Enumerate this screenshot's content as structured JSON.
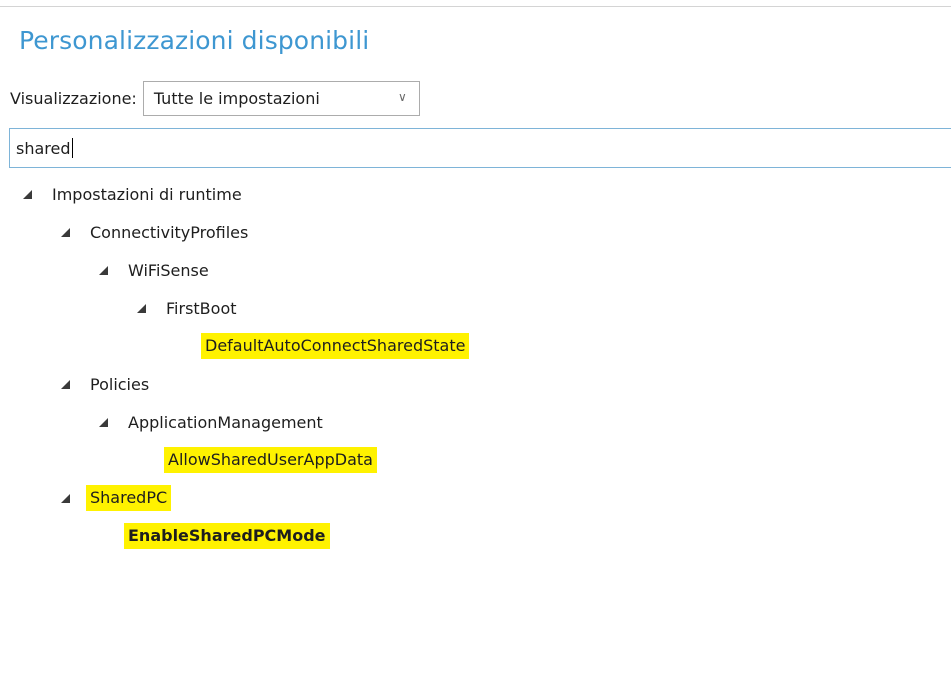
{
  "header": {
    "title": "Personalizzazioni disponibili"
  },
  "view": {
    "label": "Visualizzazione:",
    "selected": "Tutte le impostazioni"
  },
  "search": {
    "value": "shared"
  },
  "tree": {
    "runtime_settings": "Impostazioni di runtime",
    "connectivity_profiles": "ConnectivityProfiles",
    "wifisense": "WiFiSense",
    "firstboot": "FirstBoot",
    "default_auto_connect": "DefaultAutoConnectSharedState",
    "policies": "Policies",
    "application_management": "ApplicationManagement",
    "allow_shared_user_app_data": "AllowSharedUserAppData",
    "sharedpc": "SharedPC",
    "enable_sharedpc_mode": "EnableSharedPCMode"
  },
  "colors": {
    "title": "#3e97d1",
    "highlight": "#fff200",
    "search_border": "#7eb4d8"
  },
  "icons": {
    "expanded": "collapse-triangle-icon",
    "dropdown": "chevron-down-icon"
  }
}
